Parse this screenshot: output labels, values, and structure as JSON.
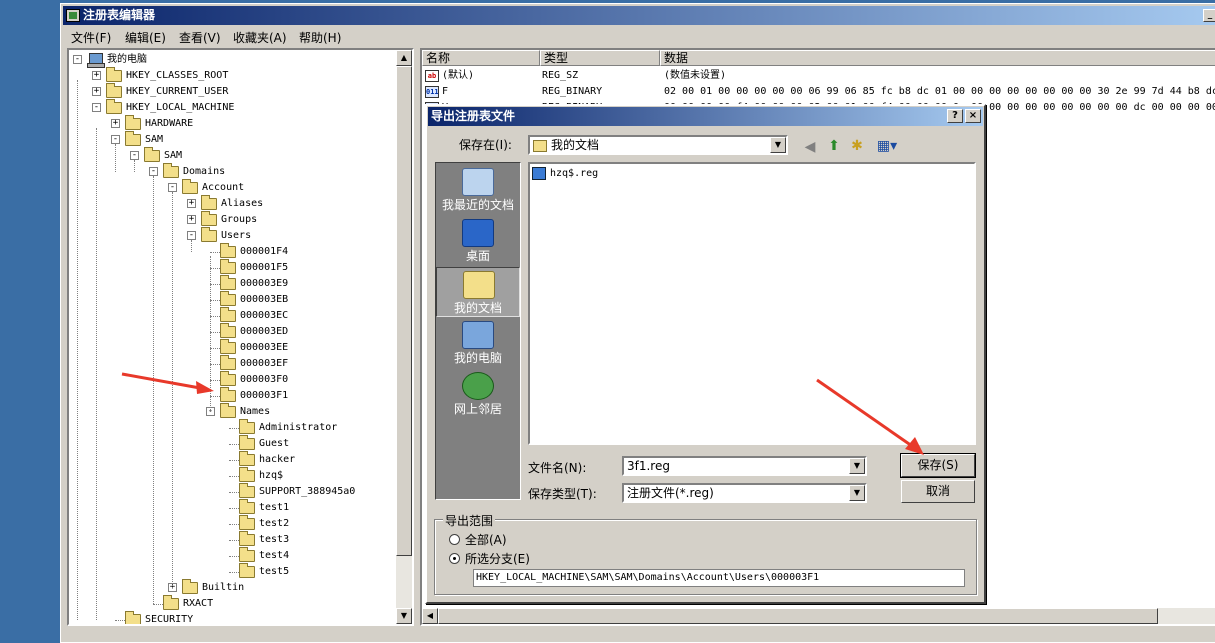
{
  "window": {
    "title": "注册表编辑器"
  },
  "menu": [
    "文件(F)",
    "编辑(E)",
    "查看(V)",
    "收藏夹(A)",
    "帮助(H)"
  ],
  "tree": [
    {
      "label": "我的电脑",
      "depth": 0,
      "exp": "-",
      "icon": "pc"
    },
    {
      "label": "HKEY_CLASSES_ROOT",
      "depth": 1,
      "exp": "+"
    },
    {
      "label": "HKEY_CURRENT_USER",
      "depth": 1,
      "exp": "+"
    },
    {
      "label": "HKEY_LOCAL_MACHINE",
      "depth": 1,
      "exp": "-"
    },
    {
      "label": "HARDWARE",
      "depth": 2,
      "exp": "+"
    },
    {
      "label": "SAM",
      "depth": 2,
      "exp": "-"
    },
    {
      "label": "SAM",
      "depth": 3,
      "exp": "-"
    },
    {
      "label": "Domains",
      "depth": 4,
      "exp": "-"
    },
    {
      "label": "Account",
      "depth": 5,
      "exp": "-"
    },
    {
      "label": "Aliases",
      "depth": 6,
      "exp": "+"
    },
    {
      "label": "Groups",
      "depth": 6,
      "exp": "+"
    },
    {
      "label": "Users",
      "depth": 6,
      "exp": "-"
    },
    {
      "label": "000001F4",
      "depth": 7,
      "exp": ""
    },
    {
      "label": "000001F5",
      "depth": 7,
      "exp": ""
    },
    {
      "label": "000003E9",
      "depth": 7,
      "exp": ""
    },
    {
      "label": "000003EB",
      "depth": 7,
      "exp": ""
    },
    {
      "label": "000003EC",
      "depth": 7,
      "exp": ""
    },
    {
      "label": "000003ED",
      "depth": 7,
      "exp": ""
    },
    {
      "label": "000003EE",
      "depth": 7,
      "exp": ""
    },
    {
      "label": "000003EF",
      "depth": 7,
      "exp": ""
    },
    {
      "label": "000003F0",
      "depth": 7,
      "exp": ""
    },
    {
      "label": "000003F1",
      "depth": 7,
      "exp": ""
    },
    {
      "label": "Names",
      "depth": 7,
      "exp": "-"
    },
    {
      "label": "Administrator",
      "depth": 8,
      "exp": ""
    },
    {
      "label": "Guest",
      "depth": 8,
      "exp": ""
    },
    {
      "label": "hacker",
      "depth": 8,
      "exp": ""
    },
    {
      "label": "hzq$",
      "depth": 8,
      "exp": ""
    },
    {
      "label": "SUPPORT_388945a0",
      "depth": 8,
      "exp": ""
    },
    {
      "label": "test1",
      "depth": 8,
      "exp": ""
    },
    {
      "label": "test2",
      "depth": 8,
      "exp": ""
    },
    {
      "label": "test3",
      "depth": 8,
      "exp": ""
    },
    {
      "label": "test4",
      "depth": 8,
      "exp": ""
    },
    {
      "label": "test5",
      "depth": 8,
      "exp": ""
    },
    {
      "label": "Builtin",
      "depth": 5,
      "exp": "+"
    },
    {
      "label": "RXACT",
      "depth": 4,
      "exp": ""
    },
    {
      "label": "SECURITY",
      "depth": 2,
      "exp": ""
    }
  ],
  "values": {
    "headers": [
      "名称",
      "类型",
      "数据"
    ],
    "rows": [
      {
        "name": "(默认)",
        "type": "REG_SZ",
        "data": "(数值未设置)",
        "icon": "ab"
      },
      {
        "name": "F",
        "type": "REG_BINARY",
        "data": "02 00 01 00 00 00 00 00 06 99 06 85 fc b8 dc 01 00 00 00 00 00 00 00 00 30 2e 99 7d 44 b8 dc",
        "icon": "bin"
      },
      {
        "name": "V",
        "type": "REG_BINARY",
        "data": "00 00 00 00 f4 00 00 00 02 00 01 00 f4 00 00 00 0e 00 00 00 00 00 00 00 00 00 dc 00 00 00 00 00 00",
        "icon": "bin"
      }
    ]
  },
  "dialog": {
    "title": "导出注册表文件",
    "help_btn": "?",
    "close_btn": "×",
    "save_in_label": "保存在(I):",
    "save_in_value": "我的文档",
    "places": [
      "我最近的文档",
      "桌面",
      "我的文档",
      "我的电脑",
      "网上邻居"
    ],
    "files": [
      "hzq$.reg"
    ],
    "filename_label": "文件名(N):",
    "filename_value": "3f1.reg",
    "filetype_label": "保存类型(T):",
    "filetype_value": "注册文件(*.reg)",
    "save_btn": "保存(S)",
    "cancel_btn": "取消",
    "export_range_title": "导出范围",
    "radio_all": "全部(A)",
    "radio_selected": "所选分支(E)",
    "selected_path": "HKEY_LOCAL_MACHINE\\SAM\\SAM\\Domains\\Account\\Users\\000003F1"
  }
}
